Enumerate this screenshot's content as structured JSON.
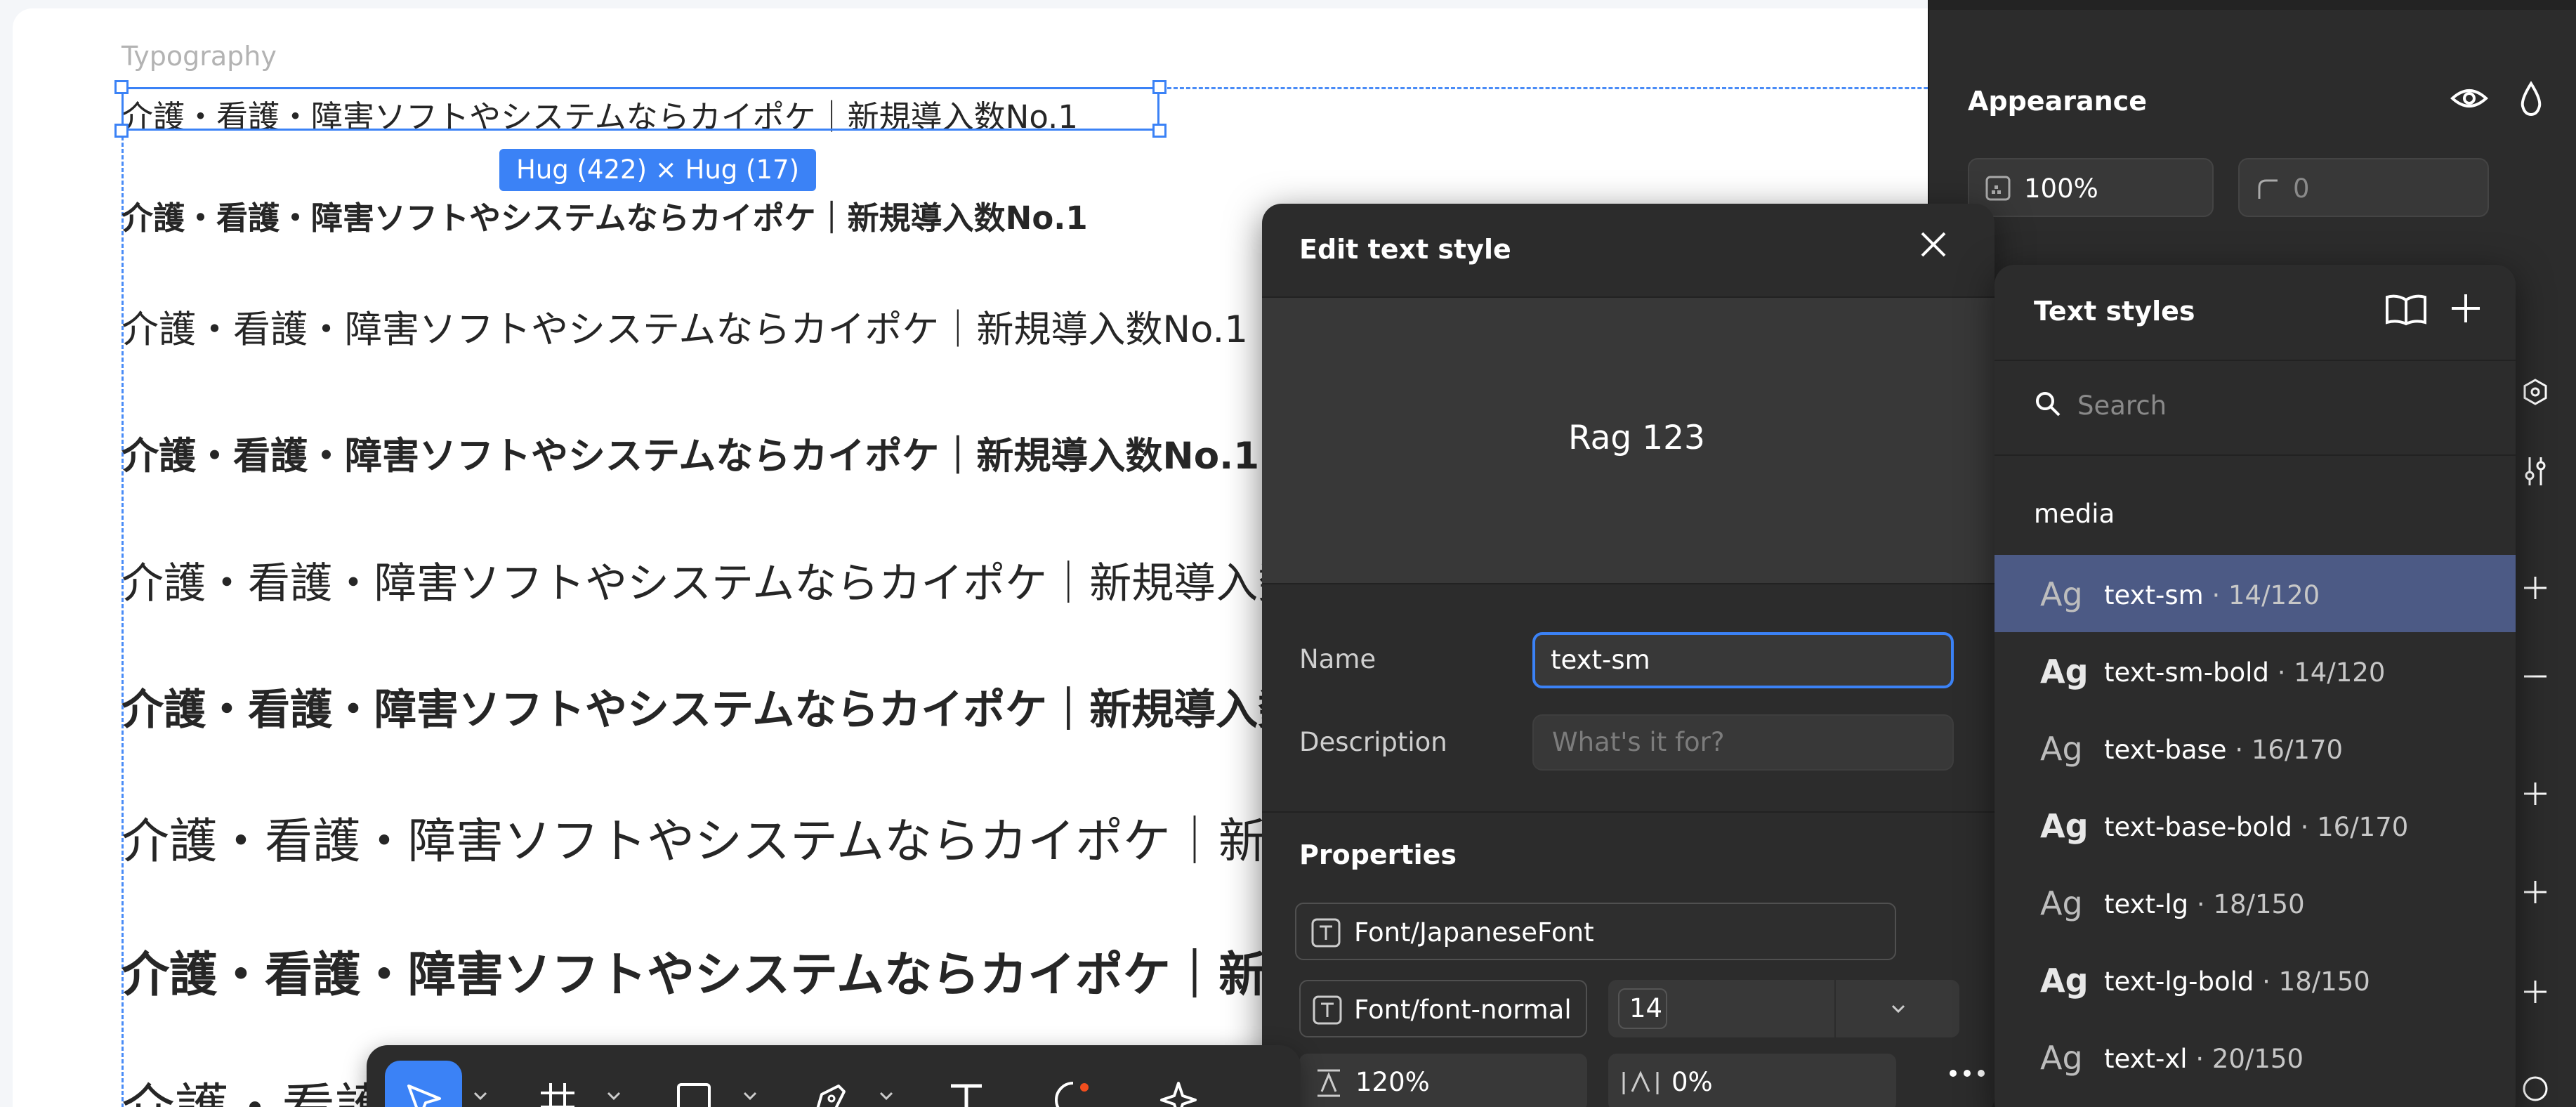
{
  "canvas": {
    "frame_label": "Typography",
    "size_badge": "Hug (422) × Hug (17)",
    "specimen_text": "介護・看護・障害ソフトやシステムならカイポケ｜新規導入数No.1"
  },
  "appearance": {
    "title": "Appearance",
    "opacity": "100%",
    "corner_radius": "0"
  },
  "edit_dialog": {
    "title": "Edit text style",
    "preview_text": "Rag 123",
    "name_label": "Name",
    "name_value": "text-sm",
    "description_label": "Description",
    "description_placeholder": "What's it for?",
    "properties_label": "Properties",
    "font_family": "Font/JapaneseFont",
    "font_weight": "Font/font-normal",
    "font_size": "14",
    "line_height": "120%",
    "letter_spacing": "0%"
  },
  "text_styles": {
    "title": "Text styles",
    "search_placeholder": "Search",
    "group": "media",
    "items": [
      {
        "ag": "Ag",
        "name": "text-sm",
        "meta": " · 14/120",
        "bold": false
      },
      {
        "ag": "Ag",
        "name": "text-sm-bold",
        "meta": " · 14/120",
        "bold": true
      },
      {
        "ag": "Ag",
        "name": "text-base",
        "meta": " · 16/170",
        "bold": false
      },
      {
        "ag": "Ag",
        "name": "text-base-bold",
        "meta": " · 16/170",
        "bold": true
      },
      {
        "ag": "Ag",
        "name": "text-lg",
        "meta": " · 18/150",
        "bold": false
      },
      {
        "ag": "Ag",
        "name": "text-lg-bold",
        "meta": " · 18/150",
        "bold": true
      },
      {
        "ag": "Ag",
        "name": "text-xl",
        "meta": " · 20/150",
        "bold": false
      }
    ]
  },
  "toolbar": {
    "tools": [
      "move-tool",
      "frame-tool",
      "shape-tool",
      "pen-tool",
      "text-tool",
      "comment-tool",
      "actions-tool"
    ]
  },
  "colors": {
    "selection": "#3b82f6",
    "panel": "#2c2c2c",
    "selected_row": "#4c5a85"
  }
}
